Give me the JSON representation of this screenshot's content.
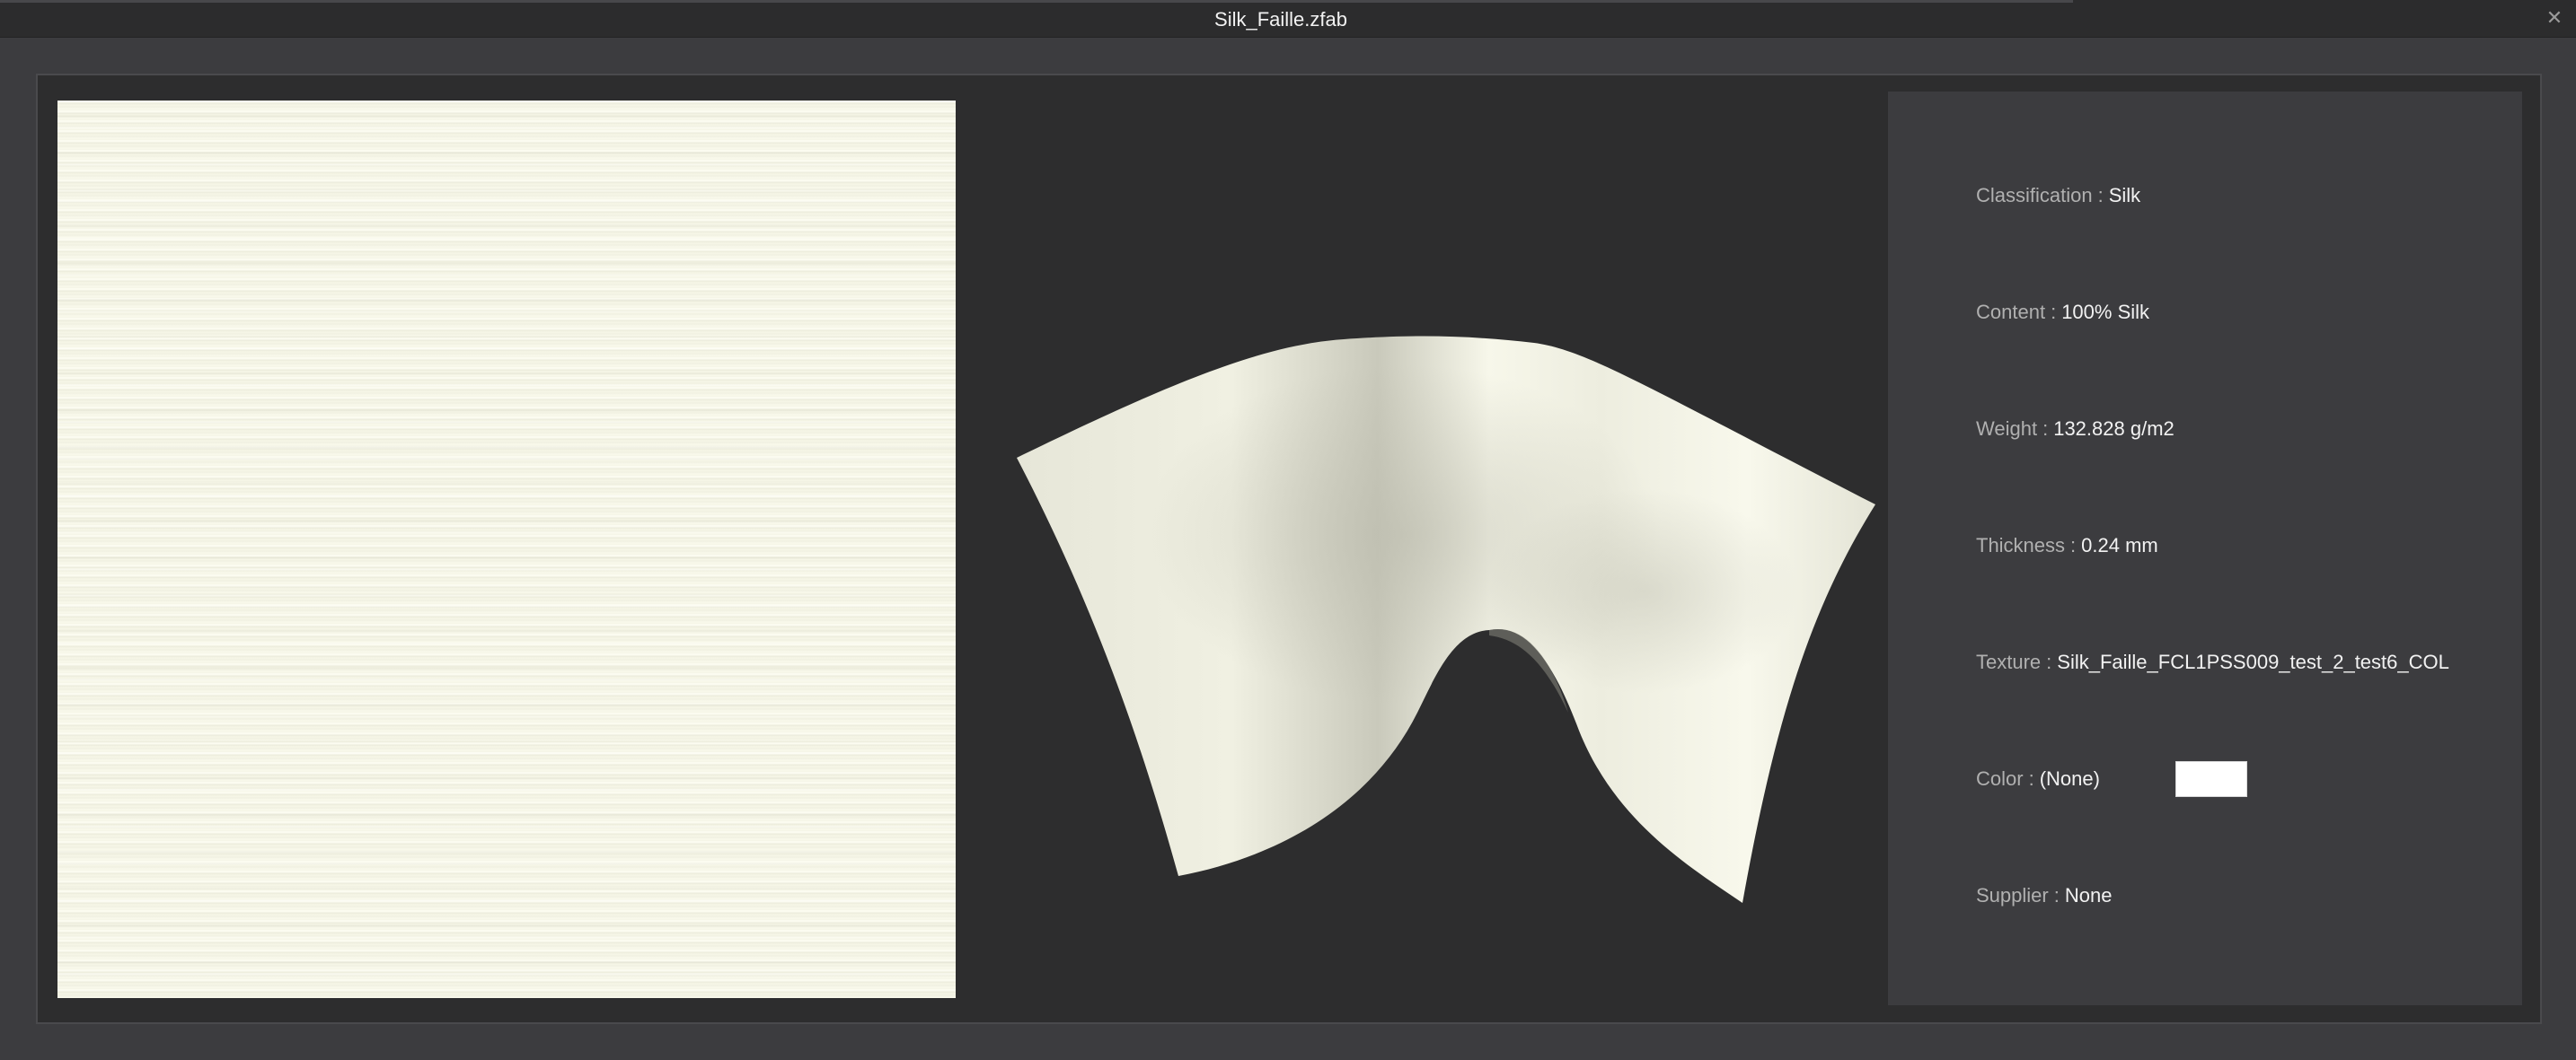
{
  "window": {
    "title": "Silk_Faille.zfab",
    "close_glyph": "✕"
  },
  "fabric": {
    "swatch_color": "#f6f6e7",
    "drape_color": "#f4f4e6"
  },
  "info": {
    "classification": {
      "label": "Classification",
      "separator": ":",
      "value": "Silk"
    },
    "content": {
      "label": "Content",
      "separator": ":",
      "value": "100% Silk"
    },
    "weight": {
      "label": "Weight",
      "separator": ":",
      "value": "132.828 g/m2"
    },
    "thickness": {
      "label": "Thickness",
      "separator": ":",
      "value": "0.24 mm"
    },
    "texture": {
      "label": "Texture",
      "separator": ":",
      "value": "Silk_Faille_FCL1PSS009_test_2_test6_COL"
    },
    "color": {
      "label": "Color",
      "separator": ":",
      "value": "(None)",
      "swatch": "#ffffff"
    },
    "supplier": {
      "label": "Supplier",
      "separator": ":",
      "value": "None"
    }
  }
}
